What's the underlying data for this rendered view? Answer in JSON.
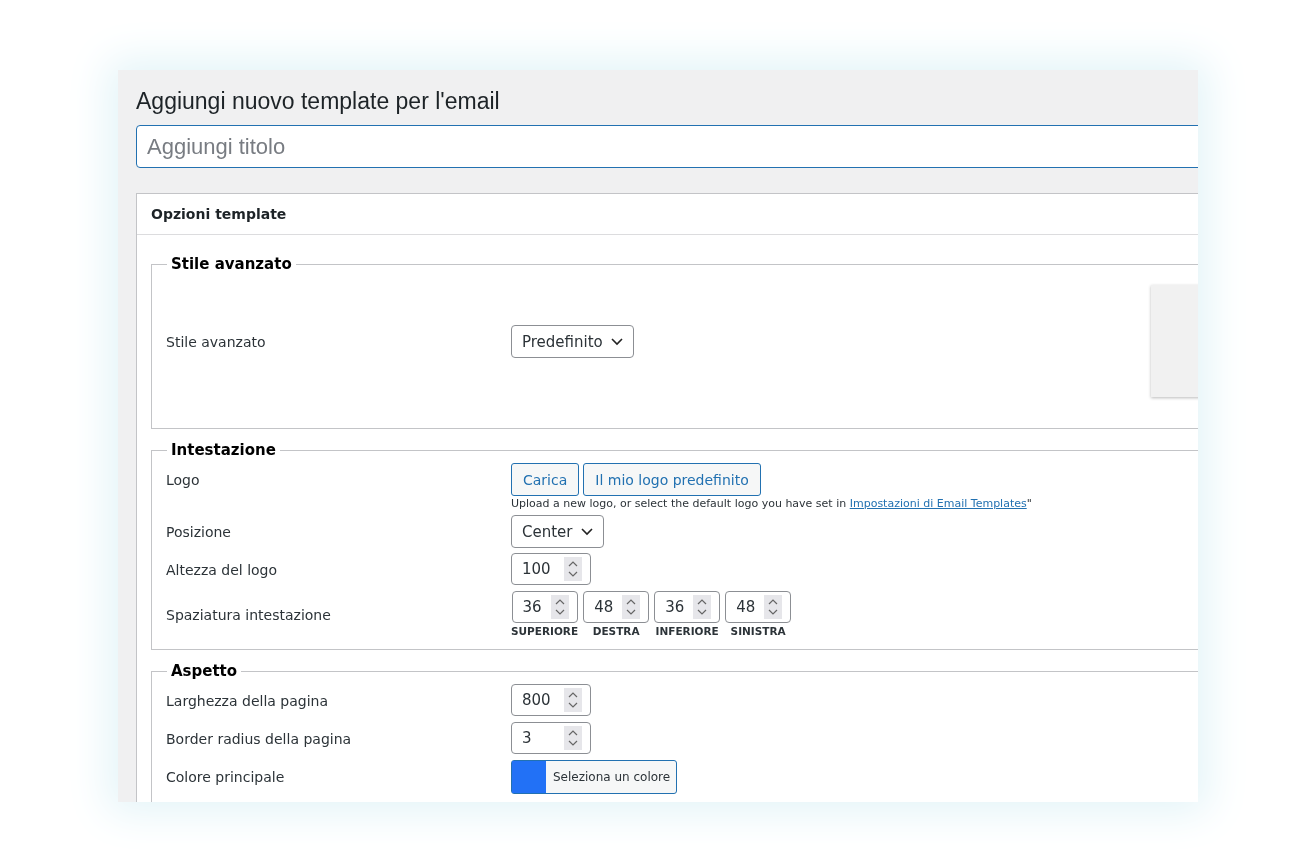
{
  "page_title": "Aggiungi nuovo template per l'email",
  "title_field": {
    "placeholder": "Aggiungi titolo"
  },
  "panel": {
    "title": "Opzioni template",
    "sections": [
      {
        "legend": "Stile avanzato",
        "preview": true,
        "rows": [
          {
            "kind": "select",
            "label": "Stile avanzato",
            "value": "Predefinito"
          }
        ]
      },
      {
        "legend": "Intestazione",
        "preview": false,
        "rows": [
          {
            "kind": "buttons",
            "label": "Logo",
            "buttons": [
              "Carica",
              "Il mio logo predefinito"
            ],
            "help": "Upload a new logo, or select the default logo you have set in",
            "link": "Impostazioni di Email Templates",
            "help_end": "\""
          },
          {
            "kind": "select",
            "label": "Posizione",
            "value": "Center"
          },
          {
            "kind": "number",
            "label": "Altezza del logo",
            "value": "100"
          },
          {
            "kind": "numbers",
            "label": "Spaziatura intestazione",
            "fields": [
              {
                "value": "36",
                "caption": "SUPERIORE"
              },
              {
                "value": "48",
                "caption": "DESTRA"
              },
              {
                "value": "36",
                "caption": "INFERIORE"
              },
              {
                "value": "48",
                "caption": "SINISTRA"
              }
            ]
          }
        ]
      },
      {
        "legend": "Aspetto",
        "preview": false,
        "rows": [
          {
            "kind": "number",
            "label": "Larghezza della pagina",
            "value": "800"
          },
          {
            "kind": "number",
            "label": "Border radius della pagina",
            "value": "3"
          },
          {
            "kind": "color",
            "label": "Colore principale",
            "color": "#2271f6",
            "button": "Seleziona un colore"
          }
        ]
      }
    ]
  }
}
